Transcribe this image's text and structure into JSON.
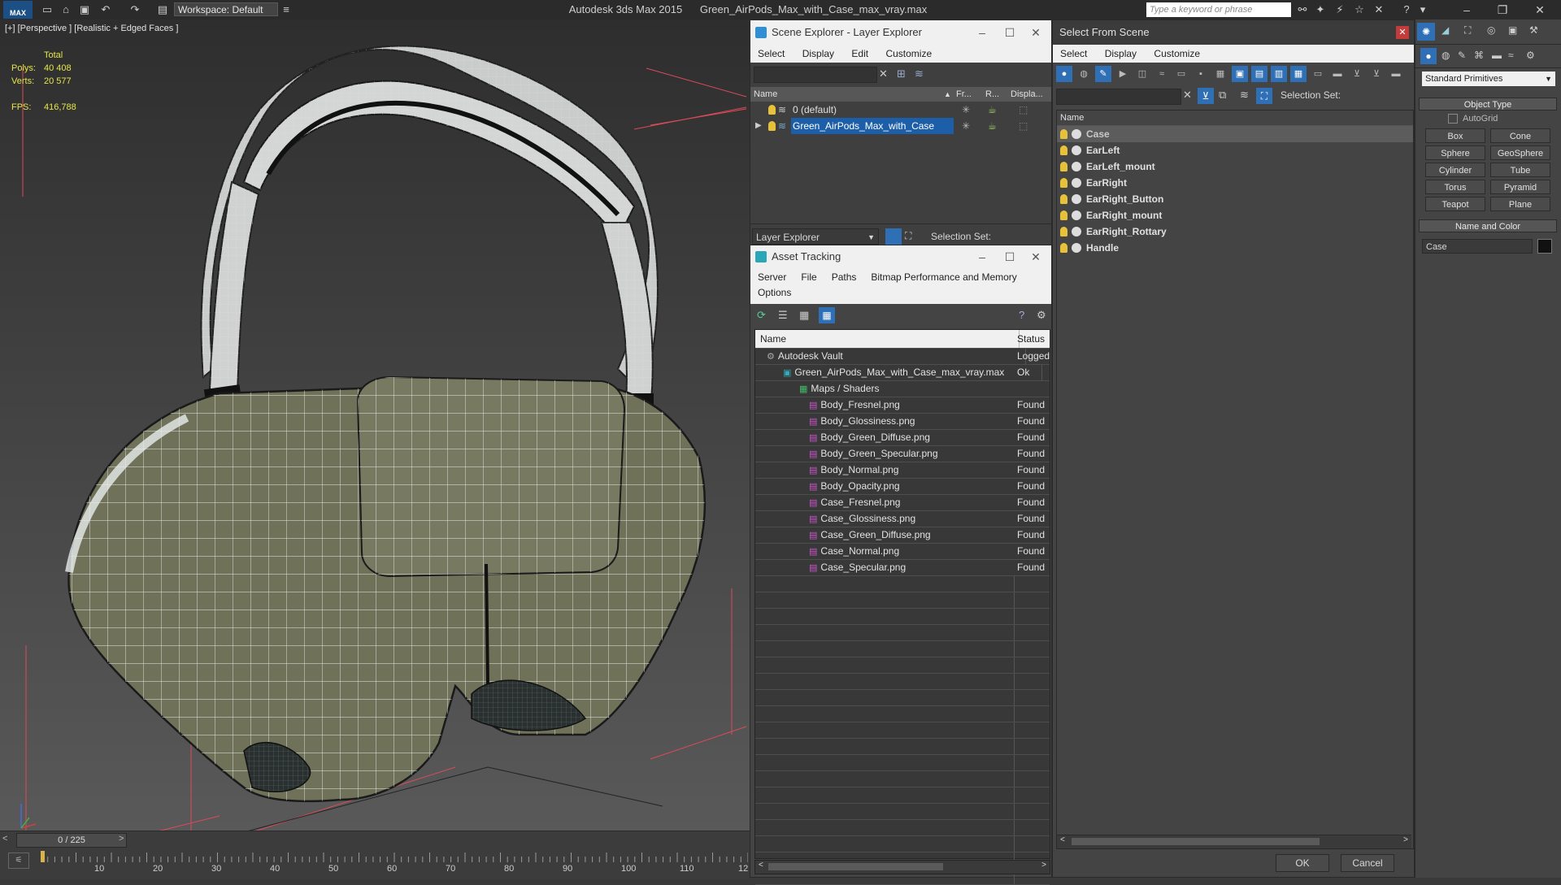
{
  "titlebar": {
    "logo": "MAX",
    "workspace": "Workspace: Default",
    "app_name": "Autodesk 3ds Max  2015",
    "file_name": "Green_AirPods_Max_with_Case_max_vray.max",
    "search_placeholder": "Type a keyword or phrase"
  },
  "viewport": {
    "label": "[+] [Perspective ] [Realistic + Edged Faces ]",
    "stats": {
      "total_label": "Total",
      "polys_label": "Polys:",
      "polys": "40 408",
      "verts_label": "Verts:",
      "verts": "20 577",
      "fps_label": "FPS:",
      "fps": "416,788"
    }
  },
  "timeline": {
    "frame": "0 / 225",
    "ticks": [
      "10",
      "20",
      "30",
      "40",
      "50",
      "60",
      "70",
      "80",
      "90",
      "100",
      "110",
      "12"
    ]
  },
  "scene_explorer": {
    "title": "Scene Explorer - Layer Explorer",
    "menu": [
      "Select",
      "Display",
      "Edit",
      "Customize"
    ],
    "columns": [
      "Name",
      "Fr...",
      "R...",
      "Displa..."
    ],
    "rows": [
      "0 (default)",
      "Green_AirPods_Max_with_Case"
    ],
    "footer_dropdown": "Layer Explorer",
    "selection_set_label": "Selection Set:"
  },
  "asset_tracking": {
    "title": "Asset Tracking",
    "menu": [
      "Server",
      "File",
      "Paths",
      "Bitmap Performance and Memory"
    ],
    "menu2": "Options",
    "columns": [
      "Name",
      "Status"
    ],
    "rows": [
      {
        "name": "Autodesk Vault",
        "status": "Logged",
        "indent": 1
      },
      {
        "name": "Green_AirPods_Max_with_Case_max_vray.max",
        "status": "Ok",
        "indent": 2
      },
      {
        "name": "Maps / Shaders",
        "status": "",
        "indent": 3
      },
      {
        "name": "Body_Fresnel.png",
        "status": "Found",
        "indent": 4
      },
      {
        "name": "Body_Glossiness.png",
        "status": "Found",
        "indent": 4
      },
      {
        "name": "Body_Green_Diffuse.png",
        "status": "Found",
        "indent": 4
      },
      {
        "name": "Body_Green_Specular.png",
        "status": "Found",
        "indent": 4
      },
      {
        "name": "Body_Normal.png",
        "status": "Found",
        "indent": 4
      },
      {
        "name": "Body_Opacity.png",
        "status": "Found",
        "indent": 4
      },
      {
        "name": "Case_Fresnel.png",
        "status": "Found",
        "indent": 4
      },
      {
        "name": "Case_Glossiness.png",
        "status": "Found",
        "indent": 4
      },
      {
        "name": "Case_Green_Diffuse.png",
        "status": "Found",
        "indent": 4
      },
      {
        "name": "Case_Normal.png",
        "status": "Found",
        "indent": 4
      },
      {
        "name": "Case_Specular.png",
        "status": "Found",
        "indent": 4
      }
    ]
  },
  "select_from_scene": {
    "title": "Select From Scene",
    "menu": [
      "Select",
      "Display",
      "Customize"
    ],
    "selection_set_label": "Selection Set:",
    "column": "Name",
    "objects": [
      "Case",
      "EarLeft",
      "EarLeft_mount",
      "EarRight",
      "EarRight_Button",
      "EarRight_mount",
      "EarRight_Rottary",
      "Handle"
    ],
    "ok": "OK",
    "cancel": "Cancel"
  },
  "command_panel": {
    "dropdown": "Standard Primitives",
    "object_type": "Object Type",
    "autogrid": "AutoGrid",
    "buttons": [
      "Box",
      "Cone",
      "Sphere",
      "GeoSphere",
      "Cylinder",
      "Tube",
      "Torus",
      "Pyramid",
      "Teapot",
      "Plane"
    ],
    "name_and_color": "Name and Color",
    "name_value": "Case",
    "object_color": "#111111"
  },
  "colors": {
    "selection_blue": "#1c5ea8",
    "stats_yellow": "#e6e647",
    "mesh_green": "#6f7259"
  }
}
